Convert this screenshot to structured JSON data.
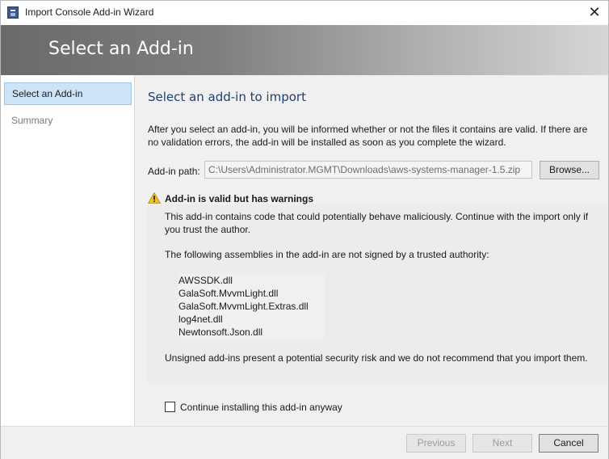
{
  "window": {
    "title": "Import Console Add-in Wizard",
    "close_glyph": "✕"
  },
  "banner": {
    "title": "Select an Add-in"
  },
  "sidebar": {
    "items": [
      {
        "label": "Select an Add-in",
        "selected": true
      },
      {
        "label": "Summary",
        "selected": false
      }
    ]
  },
  "main": {
    "heading": "Select an add-in to import",
    "intro_line1": "After you select an add-in, you will be informed whether or not the files it contains are valid. If there are",
    "intro_line2": "no validation errors, the add-in will be installed as soon as you complete the wizard.",
    "path_label": "Add-in path:",
    "path_value": "C:\\Users\\Administrator.MGMT\\Downloads\\aws-systems-manager-1.5.zip",
    "browse_label": "Browse...",
    "warning": {
      "icon": "warning-triangle-icon",
      "title": "Add-in is valid but has warnings",
      "p1_line1": "This add-in contains code that could potentially behave maliciously. Continue with the import only if",
      "p1_line2": "you trust the author.",
      "p2": "The following assemblies in the add-in are not signed by a trusted authority:",
      "assemblies": [
        "AWSSDK.dll",
        "GalaSoft.MvvmLight.dll",
        "GalaSoft.MvvmLight.Extras.dll",
        "log4net.dll",
        "Newtonsoft.Json.dll"
      ],
      "p3": "Unsigned add-ins present a potential security risk and we do not recommend that you import them."
    },
    "checkbox_label": "Continue installing this add-in anyway",
    "checkbox_checked": false
  },
  "footer": {
    "previous_label": "Previous",
    "next_label": "Next",
    "cancel_label": "Cancel"
  },
  "colors": {
    "heading": "#1f3f6e",
    "selected_nav": "#cce4f7",
    "warning_icon": "#f2c12e"
  }
}
